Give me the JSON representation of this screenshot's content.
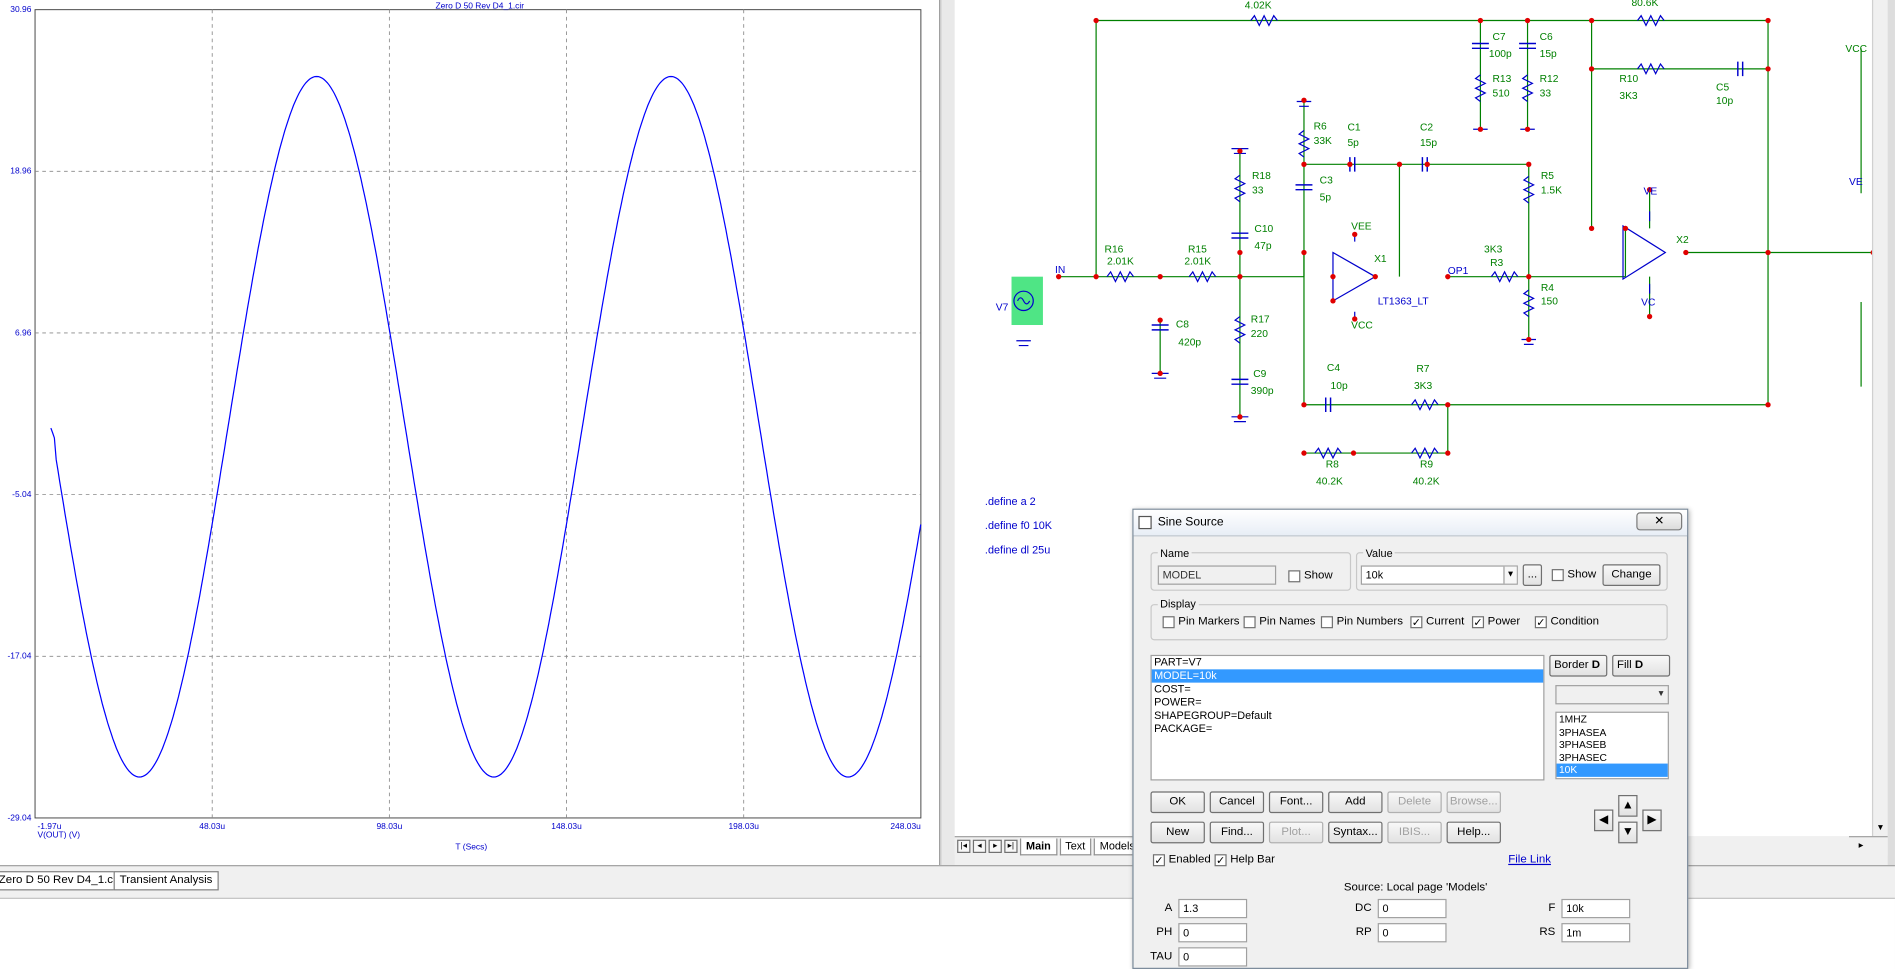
{
  "plot": {
    "title": "Zero D 50 Rev D4_1.cir",
    "y_ticks": [
      "30.96",
      "18.96",
      "6.96",
      "-5.04",
      "-17.04",
      "-29.04"
    ],
    "x_ticks": [
      "-1.97u",
      "48.03u",
      "98.03u",
      "148.03u",
      "198.03u",
      "248.03u"
    ],
    "y_trace_label": "V(OUT) (V)",
    "x_label": "T (Secs)",
    "trace_color": "#0000ff"
  },
  "chart_data": {
    "type": "line",
    "title": "Zero D 50 Rev D4_1.cir",
    "xlabel": "T (Secs)",
    "ylabel": "V(OUT) (V)",
    "xlim": [
      -1.97,
      248.03
    ],
    "ylim": [
      -29.04,
      30.96
    ],
    "series": [
      {
        "name": "V(OUT) (V)",
        "amplitude": 26.0,
        "frequency_khz": 10,
        "phase_deg": 180
      }
    ]
  },
  "schematic": {
    "component_labels": [
      "4.02K",
      "80.6K",
      "C7",
      "100p",
      "C6",
      "15p",
      "R13",
      "510",
      "R12",
      "33",
      "R10",
      "3K3",
      "C5",
      "10p",
      "R6",
      "33K",
      "C1",
      "5p",
      "C2",
      "15p",
      "C3",
      "5p",
      "R5",
      "1.5K",
      "R18",
      "33",
      "C10",
      "47p",
      "VEE",
      "X1",
      "R16",
      "2.01K",
      "R15",
      "2.01K",
      "OP1",
      "3K3",
      "R3",
      "R4",
      "150",
      "LT1363_LT",
      "VCC",
      "C8",
      "420p",
      "R17",
      "220",
      "C9",
      "390p",
      "C4",
      "10p",
      "R7",
      "3K3",
      "R8",
      "40.2K",
      "R9",
      "40.2K",
      "X2",
      "VE",
      "VC",
      "VCC",
      "VE"
    ],
    "source_label": "V7",
    "node_in": "IN",
    "defines": [
      ".define a 2",
      ".define f0 10K",
      ".define dl 25u"
    ]
  },
  "page_tabs": [
    "Main",
    "Text",
    "Models"
  ],
  "doc_tabs": [
    "Zero D 50 Rev D4_1.cir",
    "Transient Analysis"
  ],
  "dialog": {
    "title": "Sine Source",
    "close": "✕",
    "name_group": "Name",
    "name_value": "MODEL",
    "show_label": "Show",
    "value_group": "Value",
    "value_value": "10k",
    "ellipsis": "...",
    "change": "Change",
    "display_group": "Display",
    "display_opts": [
      {
        "label": "Pin Markers",
        "checked": false
      },
      {
        "label": "Pin Names",
        "checked": false
      },
      {
        "label": "Pin Numbers",
        "checked": false
      },
      {
        "label": "Current",
        "checked": true
      },
      {
        "label": "Power",
        "checked": true
      },
      {
        "label": "Condition",
        "checked": true
      }
    ],
    "attributes": [
      "PART=V7",
      "MODEL=10k",
      "COST=",
      "POWER=",
      "SHAPEGROUP=Default",
      "PACKAGE="
    ],
    "border_btn": "Border",
    "fill_btn": "Fill",
    "models": [
      "1MHZ",
      "3PHASEA",
      "3PHASEB",
      "3PHASEC",
      "10K"
    ],
    "buttons_row1": [
      "OK",
      "Cancel",
      "Font...",
      "Add",
      "Delete",
      "Browse..."
    ],
    "buttons_row2": [
      "New",
      "Find...",
      "Plot...",
      "Syntax...",
      "IBIS...",
      "Help..."
    ],
    "enabled_label": "Enabled",
    "helpbar_label": "Help Bar",
    "file_link": "File Link",
    "source_note": "Source: Local page 'Models'",
    "params": [
      {
        "name": "A",
        "value": "1.3"
      },
      {
        "name": "DC",
        "value": "0"
      },
      {
        "name": "F",
        "value": "10k"
      },
      {
        "name": "PH",
        "value": "0"
      },
      {
        "name": "RP",
        "value": "0"
      },
      {
        "name": "RS",
        "value": "1m"
      },
      {
        "name": "TAU",
        "value": "0"
      }
    ]
  }
}
